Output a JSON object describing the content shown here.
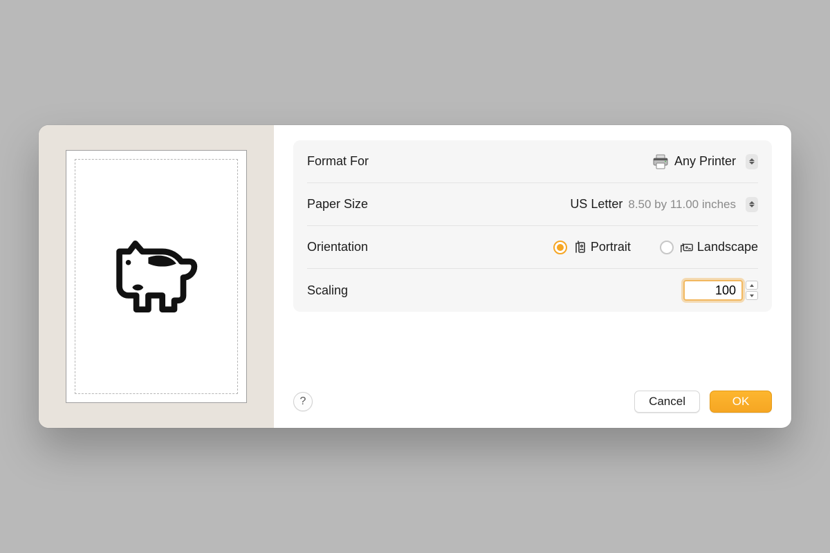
{
  "labels": {
    "format_for": "Format For",
    "paper_size": "Paper Size",
    "orientation": "Orientation",
    "scaling": "Scaling"
  },
  "format_for": {
    "selected": "Any Printer"
  },
  "paper_size": {
    "selected": "US Letter",
    "dimensions": "8.50 by 11.00 inches"
  },
  "orientation": {
    "portrait_label": "Portrait",
    "landscape_label": "Landscape",
    "selected": "portrait"
  },
  "scaling": {
    "value": "100"
  },
  "buttons": {
    "help": "?",
    "cancel": "Cancel",
    "ok": "OK"
  },
  "colors": {
    "accent": "#f6a623"
  }
}
